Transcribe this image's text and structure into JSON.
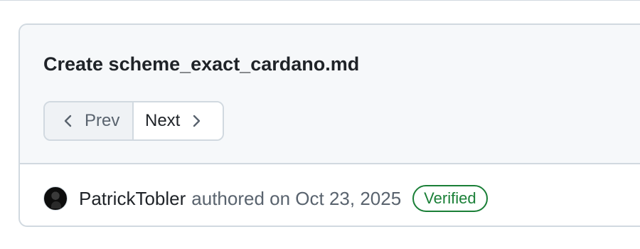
{
  "commit": {
    "title": "Create scheme_exact_cardano.md",
    "pager": {
      "prev_label": "Prev",
      "next_label": "Next",
      "prev_icon": "chevron-left-icon",
      "next_icon": "chevron-right-icon"
    },
    "author": "PatrickTobler",
    "authored_text": "authored on Oct 23, 2025",
    "badge": "Verified"
  },
  "colors": {
    "header_bg": "#f6f8fa",
    "border": "#d1d9e0",
    "verified": "#1a7f37",
    "muted_text": "#59636e"
  }
}
